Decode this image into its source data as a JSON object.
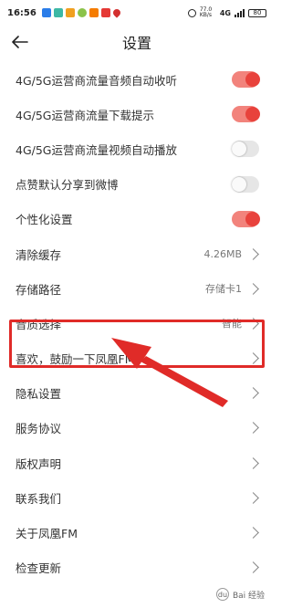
{
  "status_bar": {
    "time": "16:56",
    "network_speed": "77.0 KB/s",
    "network_type": "4G",
    "battery": "80",
    "icon_colors": [
      "#2b7de9",
      "#3db8a5",
      "#f0a020",
      "#8bc34a",
      "#f57c00",
      "#e53935",
      "#d32f2f"
    ]
  },
  "header": {
    "title": "设置"
  },
  "settings": {
    "items": [
      {
        "label": "4G/5G运营商流量音频自动收听",
        "type": "toggle",
        "on": true
      },
      {
        "label": "4G/5G运营商流量下载提示",
        "type": "toggle",
        "on": true
      },
      {
        "label": "4G/5G运营商流量视频自动播放",
        "type": "toggle",
        "on": false
      },
      {
        "label": "点赞默认分享到微博",
        "type": "toggle",
        "on": false
      },
      {
        "label": "个性化设置",
        "type": "toggle",
        "on": true
      },
      {
        "label": "清除缓存",
        "type": "link",
        "value": "4.26MB"
      },
      {
        "label": "存储路径",
        "type": "link",
        "value": "存储卡1"
      },
      {
        "label": "音质选择",
        "type": "link",
        "value": "智能"
      },
      {
        "label": "喜欢，鼓励一下凤凰FM",
        "type": "link",
        "value": ""
      },
      {
        "label": "隐私设置",
        "type": "link",
        "value": ""
      },
      {
        "label": "服务协议",
        "type": "link",
        "value": ""
      },
      {
        "label": "版权声明",
        "type": "link",
        "value": ""
      },
      {
        "label": "联系我们",
        "type": "link",
        "value": ""
      },
      {
        "label": "关于凤凰FM",
        "type": "link",
        "value": ""
      },
      {
        "label": "检查更新",
        "type": "link",
        "value": ""
      }
    ]
  },
  "annotation": {
    "highlighted_item": "音质选择",
    "color": "#e02b28"
  },
  "watermark": {
    "text": "Bai 经验",
    "logo": "du"
  },
  "colors": {
    "toggle_on_track": "#f2837c",
    "toggle_on_knob": "#e8423c",
    "toggle_off_track": "#e6e6e6"
  }
}
